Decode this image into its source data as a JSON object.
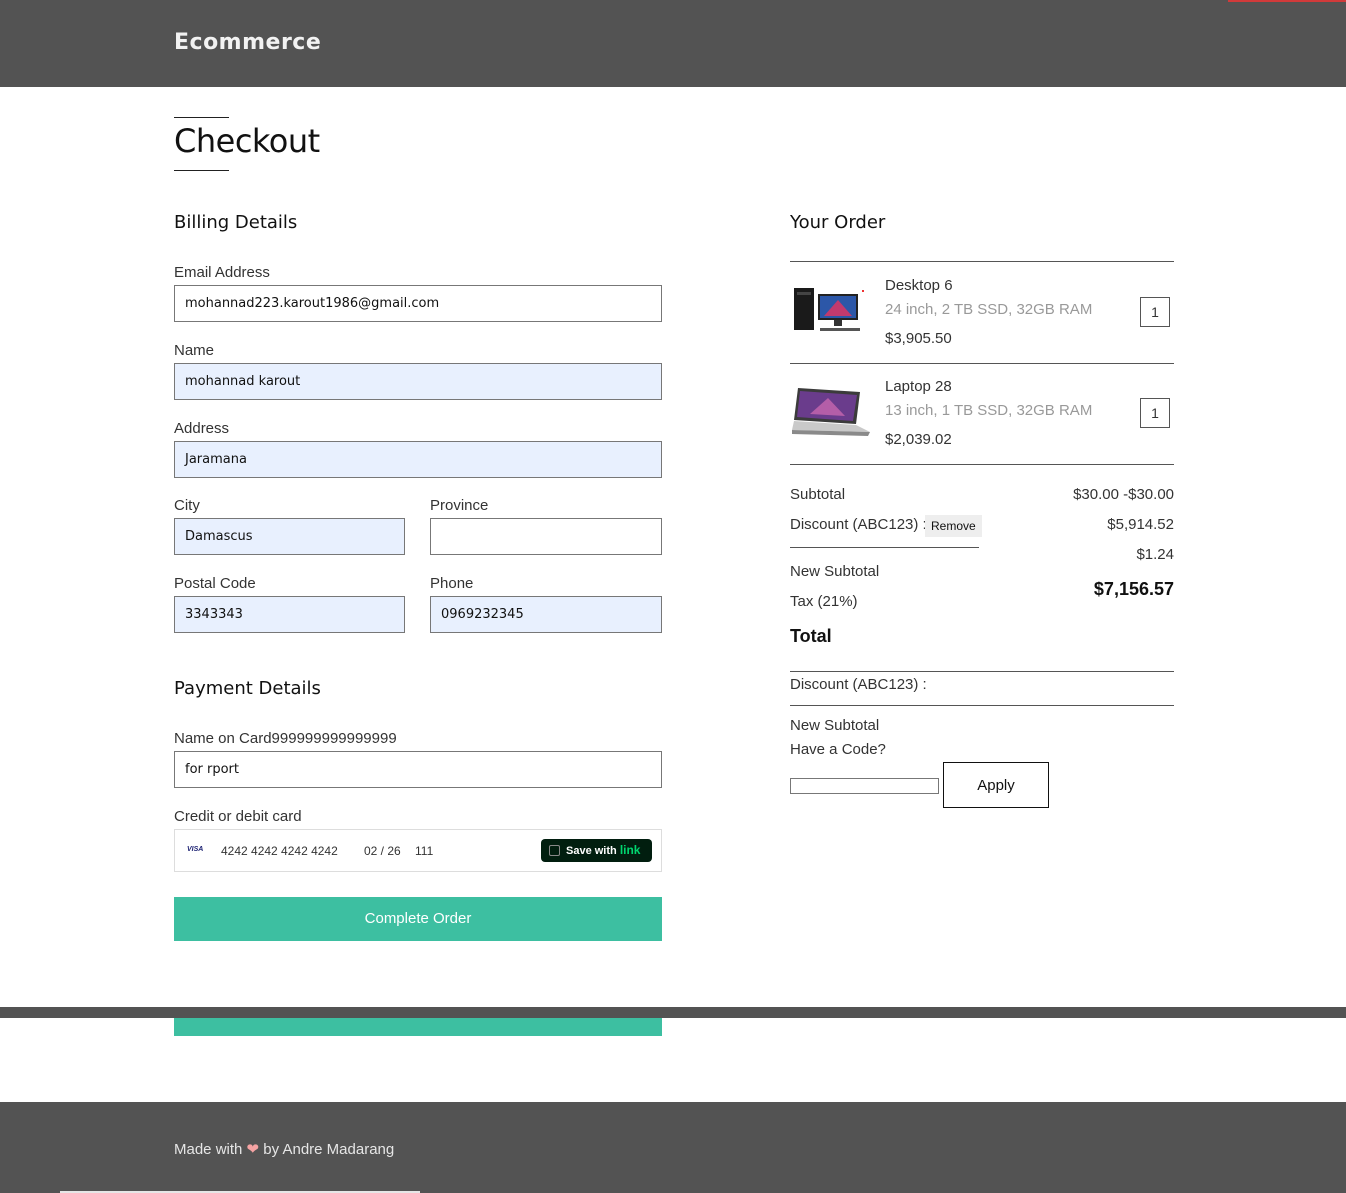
{
  "header": {
    "brand": "Ecommerce"
  },
  "page": {
    "title": "Checkout"
  },
  "billing": {
    "heading": "Billing Details",
    "email_label": "Email Address",
    "email_value": "mohannad223.karout1986@gmail.com",
    "name_label": "Name",
    "name_value": "mohannad karout",
    "address_label": "Address",
    "address_value": "Jaramana",
    "city_label": "City",
    "city_value": "Damascus",
    "province_label": "Province",
    "province_value": "",
    "postal_label": "Postal Code",
    "postal_value": "3343343",
    "phone_label": "Phone",
    "phone_value": "0969232345"
  },
  "payment": {
    "heading": "Payment Details",
    "name_on_card_label": "Name on Card999999999999999",
    "name_on_card_value": "for rport",
    "card_label": "Credit or debit card",
    "card_brand": "VISA",
    "card_number": "4242 4242 4242 4242",
    "card_expiry": "02 / 26",
    "card_cvc": "111",
    "link_save_text": "Save with",
    "link_word": "link",
    "complete_label": "Complete Order"
  },
  "order": {
    "heading": "Your Order",
    "items": [
      {
        "name": "Desktop 6",
        "details": "24 inch, 2 TB SSD, 32GB RAM",
        "price": "$3,905.50",
        "qty": "1",
        "icon": "desktop-computer-image"
      },
      {
        "name": "Laptop 28",
        "details": "13 inch, 1 TB SSD, 32GB RAM",
        "price": "$2,039.02",
        "qty": "1",
        "icon": "laptop-image"
      }
    ],
    "subtotal_label": "Subtotal",
    "subtotal_value": "$30.00 -$30.00",
    "discount_label": "Discount (ABC123) :",
    "remove_label": "Remove",
    "discount_value": "$5,914.52",
    "extra_value": "$1.24",
    "new_subtotal_label": "New Subtotal",
    "tax_label": "Tax (21%)",
    "total_value": "$7,156.57",
    "total_label": "Total",
    "discount_label_2": "Discount (ABC123) :",
    "new_subtotal_label_2": "New Subtotal",
    "code_prompt": "Have a Code?",
    "code_value": "",
    "apply_label": "Apply"
  },
  "footer": {
    "prefix": "Made with",
    "heart": "❤",
    "suffix": "by Andre Madarang"
  },
  "colors": {
    "header_bg": "#535353",
    "accent": "#3dbfa1",
    "autofill_bg": "#e8f0fe"
  }
}
